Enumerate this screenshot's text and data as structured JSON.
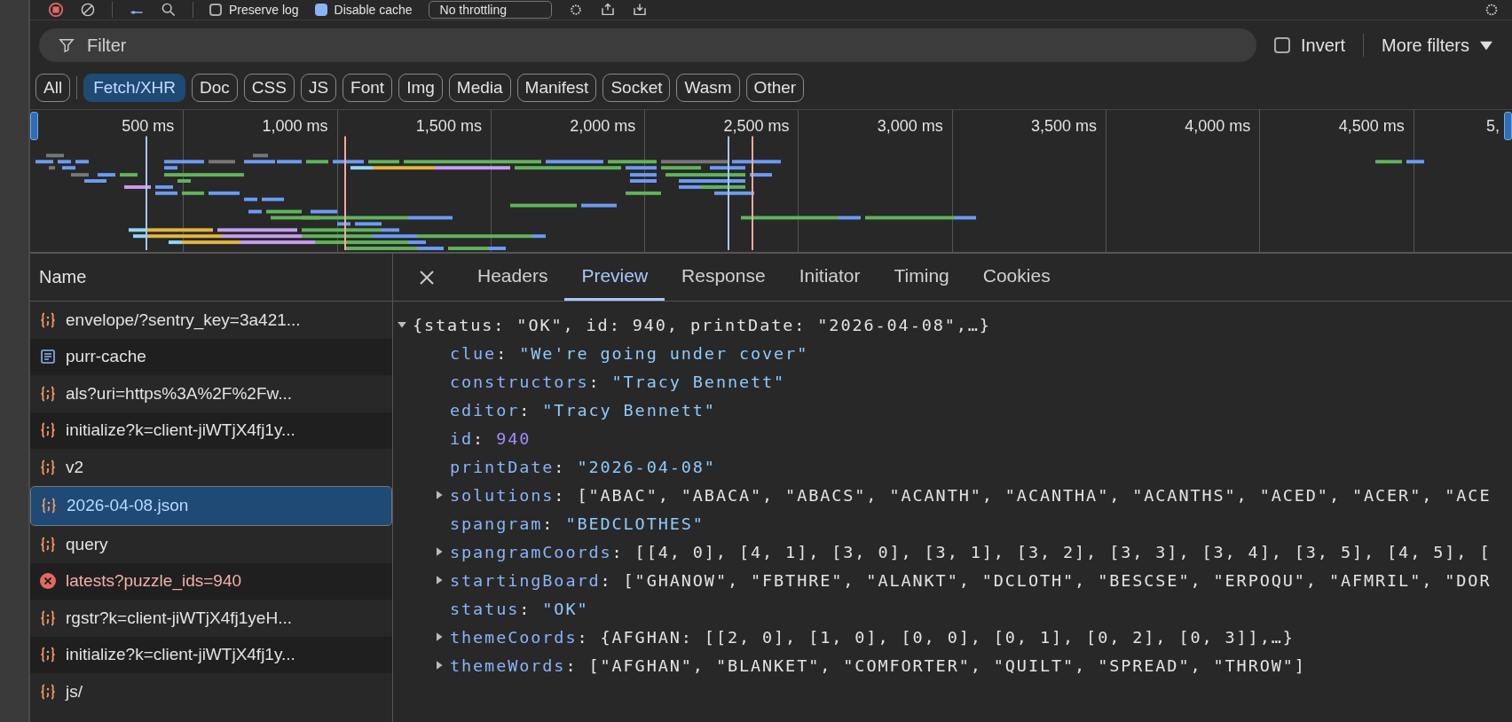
{
  "toolbar": {
    "preserve_log": {
      "label": "Preserve log",
      "checked": false
    },
    "disable_cache": {
      "label": "Disable cache",
      "checked": true
    },
    "throttling": "No throttling"
  },
  "filter": {
    "placeholder": "Filter",
    "invert": {
      "label": "Invert",
      "checked": false
    },
    "more_filters": "More filters"
  },
  "type_filters": [
    {
      "label": "All",
      "selected": false
    },
    {
      "label": "Fetch/XHR",
      "selected": true
    },
    {
      "label": "Doc",
      "selected": false
    },
    {
      "label": "CSS",
      "selected": false
    },
    {
      "label": "JS",
      "selected": false
    },
    {
      "label": "Font",
      "selected": false
    },
    {
      "label": "Img",
      "selected": false
    },
    {
      "label": "Media",
      "selected": false
    },
    {
      "label": "Manifest",
      "selected": false
    },
    {
      "label": "Socket",
      "selected": false
    },
    {
      "label": "Wasm",
      "selected": false
    },
    {
      "label": "Other",
      "selected": false
    }
  ],
  "timeline": {
    "ticks": [
      "500 ms",
      "1,000 ms",
      "1,500 ms",
      "2,000 ms",
      "2,500 ms",
      "3,000 ms",
      "3,500 ms",
      "4,000 ms",
      "4,500 ms",
      "5,"
    ]
  },
  "requests": {
    "column": "Name",
    "rows": [
      {
        "name": "envelope/?sentry_key=3a421...",
        "kind": "fetch",
        "selected": false
      },
      {
        "name": "purr-cache",
        "kind": "document",
        "selected": false
      },
      {
        "name": "als?uri=https%3A%2F%2Fw...",
        "kind": "fetch",
        "selected": false
      },
      {
        "name": "initialize?k=client-jiWTjX4fj1y...",
        "kind": "fetch",
        "selected": false
      },
      {
        "name": "v2",
        "kind": "fetch",
        "selected": false
      },
      {
        "name": "2026-04-08.json",
        "kind": "fetch",
        "selected": true
      },
      {
        "name": "query",
        "kind": "fetch",
        "selected": false
      },
      {
        "name": "latests?puzzle_ids=940",
        "kind": "error",
        "selected": false
      },
      {
        "name": "rgstr?k=client-jiWTjX4fj1yeH...",
        "kind": "fetch",
        "selected": false
      },
      {
        "name": "initialize?k=client-jiWTjX4fj1y...",
        "kind": "fetch",
        "selected": false
      },
      {
        "name": "js/",
        "kind": "fetch",
        "selected": false
      }
    ]
  },
  "detail_tabs": [
    {
      "label": "Headers",
      "selected": false
    },
    {
      "label": "Preview",
      "selected": true
    },
    {
      "label": "Response",
      "selected": false
    },
    {
      "label": "Initiator",
      "selected": false
    },
    {
      "label": "Timing",
      "selected": false
    },
    {
      "label": "Cookies",
      "selected": false
    }
  ],
  "preview": {
    "value": "{status: \"OK\", id: 940, printDate: \"2026-04-08\",…}",
    "kind": "summary",
    "expanded": true,
    "children": [
      {
        "key": "clue:",
        "value": "\"We're going under cover\"",
        "kind": "string"
      },
      {
        "key": "constructors:",
        "value": "\"Tracy Bennett\"",
        "kind": "string"
      },
      {
        "key": "editor:",
        "value": "\"Tracy Bennett\"",
        "kind": "string"
      },
      {
        "key": "id:",
        "value": "940",
        "kind": "number"
      },
      {
        "key": "printDate:",
        "value": "\"2026-04-08\"",
        "kind": "string"
      },
      {
        "key": "solutions:",
        "value": "[\"ABAC\", \"ABACA\", \"ABACS\", \"ACANTH\", \"ACANTHA\", \"ACANTHS\", \"ACED\", \"ACER\", \"ACE",
        "kind": "summary",
        "expanded": false
      },
      {
        "key": "spangram:",
        "value": "\"BEDCLOTHES\"",
        "kind": "string"
      },
      {
        "key": "spangramCoords:",
        "value": "[[4, 0], [4, 1], [3, 0], [3, 1], [3, 2], [3, 3], [3, 4], [3, 5], [4, 5], [",
        "kind": "summary",
        "expanded": false
      },
      {
        "key": "startingBoard:",
        "value": "[\"GHANOW\", \"FBTHRE\", \"ALANKT\", \"DCLOTH\", \"BESCSE\", \"ERPOQU\", \"AFMRIL\", \"DOR",
        "kind": "summary",
        "expanded": false
      },
      {
        "key": "status:",
        "value": "\"OK\"",
        "kind": "string"
      },
      {
        "key": "themeCoords:",
        "value": "{AFGHAN: [[2, 0], [1, 0], [0, 0], [0, 1], [0, 2], [0, 3]],…}",
        "kind": "summary",
        "expanded": false
      },
      {
        "key": "themeWords:",
        "value": "[\"AFGHAN\", \"BLANKET\", \"COMFORTER\", \"QUILT\", \"SPREAD\", \"THROW\"]",
        "kind": "summary",
        "expanded": false
      }
    ]
  }
}
